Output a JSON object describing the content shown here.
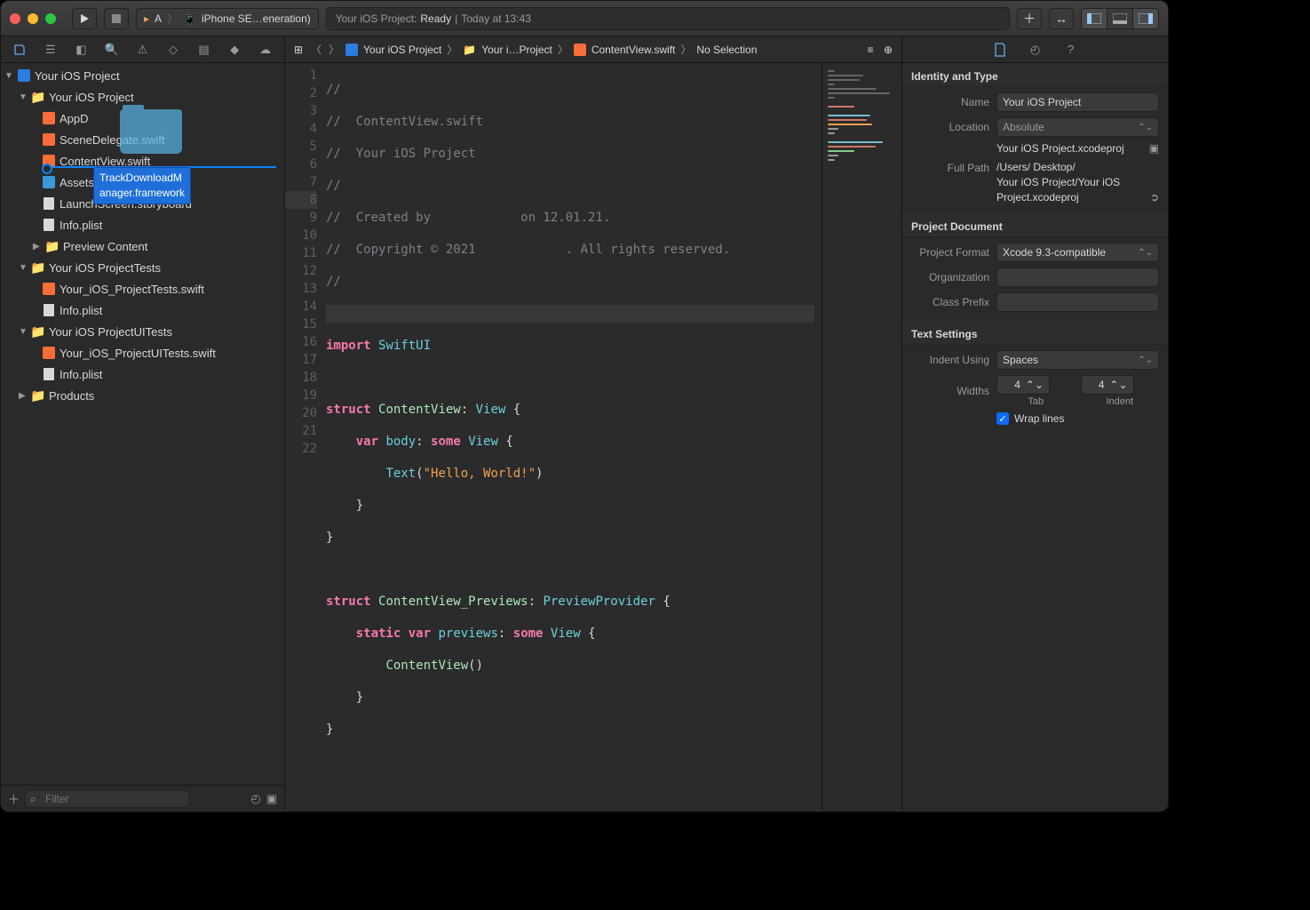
{
  "toolbar": {
    "scheme_app": "A",
    "scheme_device_label": "iPhone SE…eneration)",
    "status_project": "Your iOS Project:",
    "status_label": "Ready",
    "status_sep": " | ",
    "status_time": "Today at 13:43"
  },
  "nav": {
    "filter_placeholder": "Filter",
    "root": "Your iOS Project",
    "group": "Your iOS Project",
    "files": {
      "appdelegate": "AppDelegate.swift",
      "appdelegate_clipped": "AppD",
      "scenedelegate": "SceneDelegate.swift",
      "contentview": "ContentView.swift",
      "assets": "Assets.xcassets",
      "launch": "LaunchScreen.storyboard",
      "info": "Info.plist",
      "preview": "Preview Content"
    },
    "tests_group": "Your iOS ProjectTests",
    "tests_file": "Your_iOS_ProjectTests.swift",
    "tests_info": "Info.plist",
    "uitests_group": "Your iOS ProjectUITests",
    "uitests_file": "Your_iOS_ProjectUITests.swift",
    "uitests_info": "Info.plist",
    "products": "Products",
    "drag_label_l1": "TrackDownloadM",
    "drag_label_l2": "anager.framework"
  },
  "jumpbar": {
    "project": "Your iOS Project",
    "group": "Your i…Project",
    "file": "ContentView.swift",
    "selection": "No Selection"
  },
  "code": {
    "l1": "//",
    "l2": "//  ContentView.swift",
    "l3": "//  Your iOS Project",
    "l4": "//",
    "l5": "//  Created by            on 12.01.21.",
    "l6": "//  Copyright © 2021            . All rights reserved.",
    "l7": "//",
    "import_kw": "import",
    "import_id": "SwiftUI",
    "struct_kw": "struct",
    "cv_name": "ContentView",
    "view_ty": "View",
    "var_kw": "var",
    "body_id": "body",
    "some_kw": "some",
    "view2_ty": "View",
    "text_call": "Text",
    "hello_str": "\"Hello, World!\"",
    "cvp_name": "ContentView_Previews",
    "pp_ty": "PreviewProvider",
    "static_kw": "static",
    "previews_id": "previews",
    "cv_call": "ContentView"
  },
  "inspector": {
    "identity_h": "Identity and Type",
    "name_lbl": "Name",
    "name_val": "Your iOS Project",
    "location_lbl": "Location",
    "location_val": "Absolute",
    "location_file": "Your iOS Project.xcodeproj",
    "fullpath_lbl": "Full Path",
    "fullpath_l1": "/Users/               Desktop/",
    "fullpath_l2": "Your iOS Project/Your iOS",
    "fullpath_l3": "Project.xcodeproj",
    "projdoc_h": "Project Document",
    "format_lbl": "Project Format",
    "format_val": "Xcode 9.3-compatible",
    "org_lbl": "Organization",
    "prefix_lbl": "Class Prefix",
    "text_h": "Text Settings",
    "indent_lbl": "Indent Using",
    "indent_val": "Spaces",
    "widths_lbl": "Widths",
    "tab_val": "4",
    "indentw_val": "4",
    "tab_sub": "Tab",
    "indent_sub": "Indent",
    "wrap_lbl": "Wrap lines"
  }
}
